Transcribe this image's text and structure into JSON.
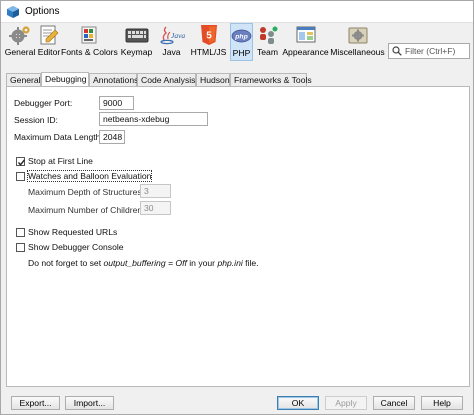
{
  "window": {
    "title": "Options"
  },
  "categories": [
    {
      "label": "General",
      "icon": "gear-icon",
      "selected": false
    },
    {
      "label": "Editor",
      "icon": "editor-icon",
      "selected": false
    },
    {
      "label": "Fonts & Colors",
      "icon": "fonts-colors-icon",
      "selected": false
    },
    {
      "label": "Keymap",
      "icon": "keymap-icon",
      "selected": false
    },
    {
      "label": "Java",
      "icon": "java-icon",
      "icon_text": "Java",
      "selected": false
    },
    {
      "label": "HTML/JS",
      "icon": "html5-icon",
      "icon_text": "5",
      "selected": false
    },
    {
      "label": "PHP",
      "icon": "php-icon",
      "icon_text": "php",
      "selected": true
    },
    {
      "label": "Team",
      "icon": "team-icon",
      "selected": false
    },
    {
      "label": "Appearance",
      "icon": "appearance-icon",
      "selected": false
    },
    {
      "label": "Miscellaneous",
      "icon": "miscellaneous-icon",
      "selected": false
    }
  ],
  "search": {
    "placeholder": "Filter (Ctrl+F)",
    "value": ""
  },
  "tabs": [
    {
      "label": "General",
      "active": false
    },
    {
      "label": "Debugging",
      "active": true
    },
    {
      "label": "Annotations",
      "active": false
    },
    {
      "label": "Code Analysis",
      "active": false
    },
    {
      "label": "Hudson",
      "active": false
    },
    {
      "label": "Frameworks & Tools",
      "active": false
    }
  ],
  "debugging": {
    "port_label": "Debugger Port:",
    "port_value": "9000",
    "session_label": "Session ID:",
    "session_value": "netbeans-xdebug",
    "maxlen_label": "Maximum Data Length:",
    "maxlen_value": "2048",
    "stop_first_line": {
      "label": "Stop at First Line",
      "checked": true
    },
    "watches": {
      "label": "Watches and Balloon Evaluation",
      "checked": false
    },
    "depth_label": "Maximum Depth of Structures:",
    "depth_value": "3",
    "children_label": "Maximum Number of Children:",
    "children_value": "30",
    "show_urls": {
      "label": "Show Requested URLs",
      "checked": false
    },
    "show_console": {
      "label": "Show Debugger Console",
      "checked": false
    },
    "note": {
      "part1": "Do not forget to set ",
      "part2": "output_buffering = Off",
      "part3": " in your ",
      "part4": "php.ini",
      "part5": " file."
    }
  },
  "buttons": {
    "export": "Export...",
    "import": "Import...",
    "ok": "OK",
    "apply": "Apply",
    "cancel": "Cancel",
    "help": "Help"
  },
  "colors": {
    "selected_category_bg": "#cfe4f7",
    "html5_orange": "#e34c26",
    "php_blue": "#6a7fc0"
  }
}
